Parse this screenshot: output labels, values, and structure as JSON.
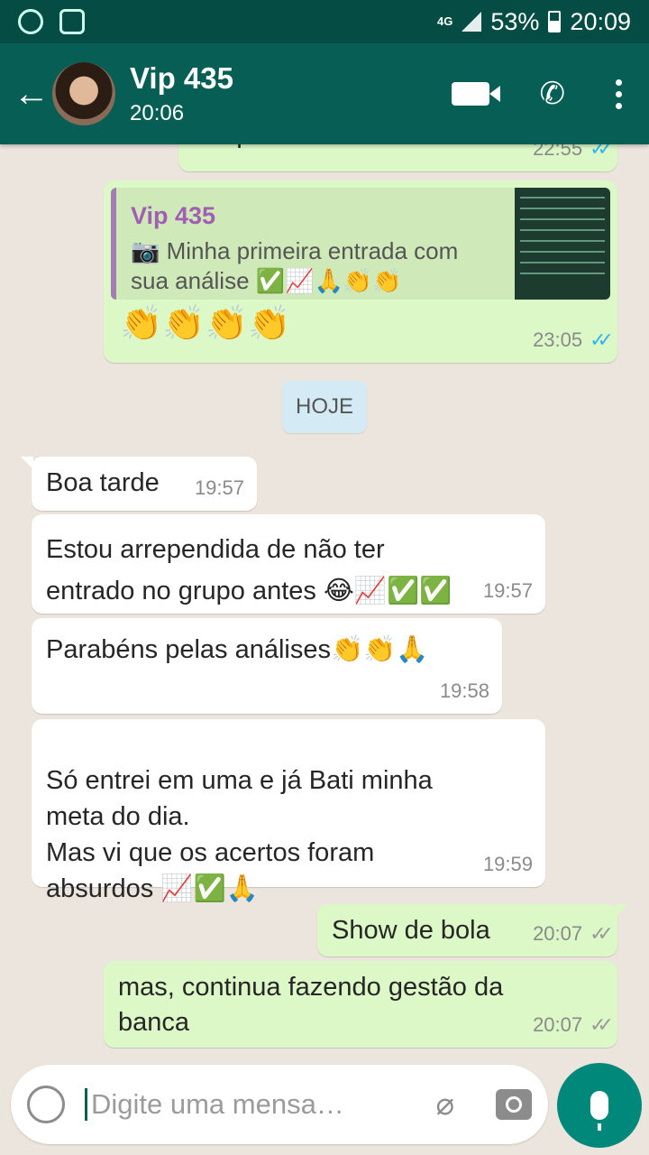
{
  "status_bar": {
    "network": "4G",
    "battery": "53%",
    "time": "20:09"
  },
  "header": {
    "contact_name": "Vip 435",
    "contact_status": "20:06"
  },
  "messages": [
    {
      "text": "só quando fechar o mês",
      "time": "22:55",
      "status": "read"
    },
    {
      "quote_name": "Vip 435",
      "quote_text": "📷 Minha primeira entrada com sua análise ✅📈🙏👏👏",
      "text": "👏👏👏👏",
      "time": "23:05",
      "status": "read"
    },
    {
      "text": "Boa tarde",
      "time": "19:57"
    },
    {
      "text": "Estou arrependida de não ter entrado no grupo antes 😂📈✅✅",
      "time": "19:57"
    },
    {
      "text": "Parabéns pelas análises👏👏🙏",
      "time": "19:58"
    },
    {
      "text": "Só entrei em uma e já Bati minha meta do dia.\nMas vi que os acertos foram absurdos 📈✅🙏",
      "time": "19:59"
    },
    {
      "text": "Show de bola",
      "time": "20:07",
      "status": "delivered"
    },
    {
      "text": "mas, continua fazendo gestão da banca",
      "time": "20:07",
      "status": "delivered"
    }
  ],
  "date_chip": "HOJE",
  "composer": {
    "placeholder": "Digite uma mensa…"
  },
  "icons": {
    "back": "arrow-left-icon",
    "video": "video-camera-icon",
    "call": "phone-icon",
    "menu": "more-vert-icon",
    "emoji": "smiley-icon",
    "attach": "paperclip-icon",
    "camera": "camera-icon",
    "mic": "microphone-icon"
  },
  "colors": {
    "header": "#075e54",
    "outgoing_bubble": "#dcf8c6",
    "incoming_bubble": "#ffffff",
    "read_ticks": "#34b7f1",
    "fab": "#00897b"
  }
}
